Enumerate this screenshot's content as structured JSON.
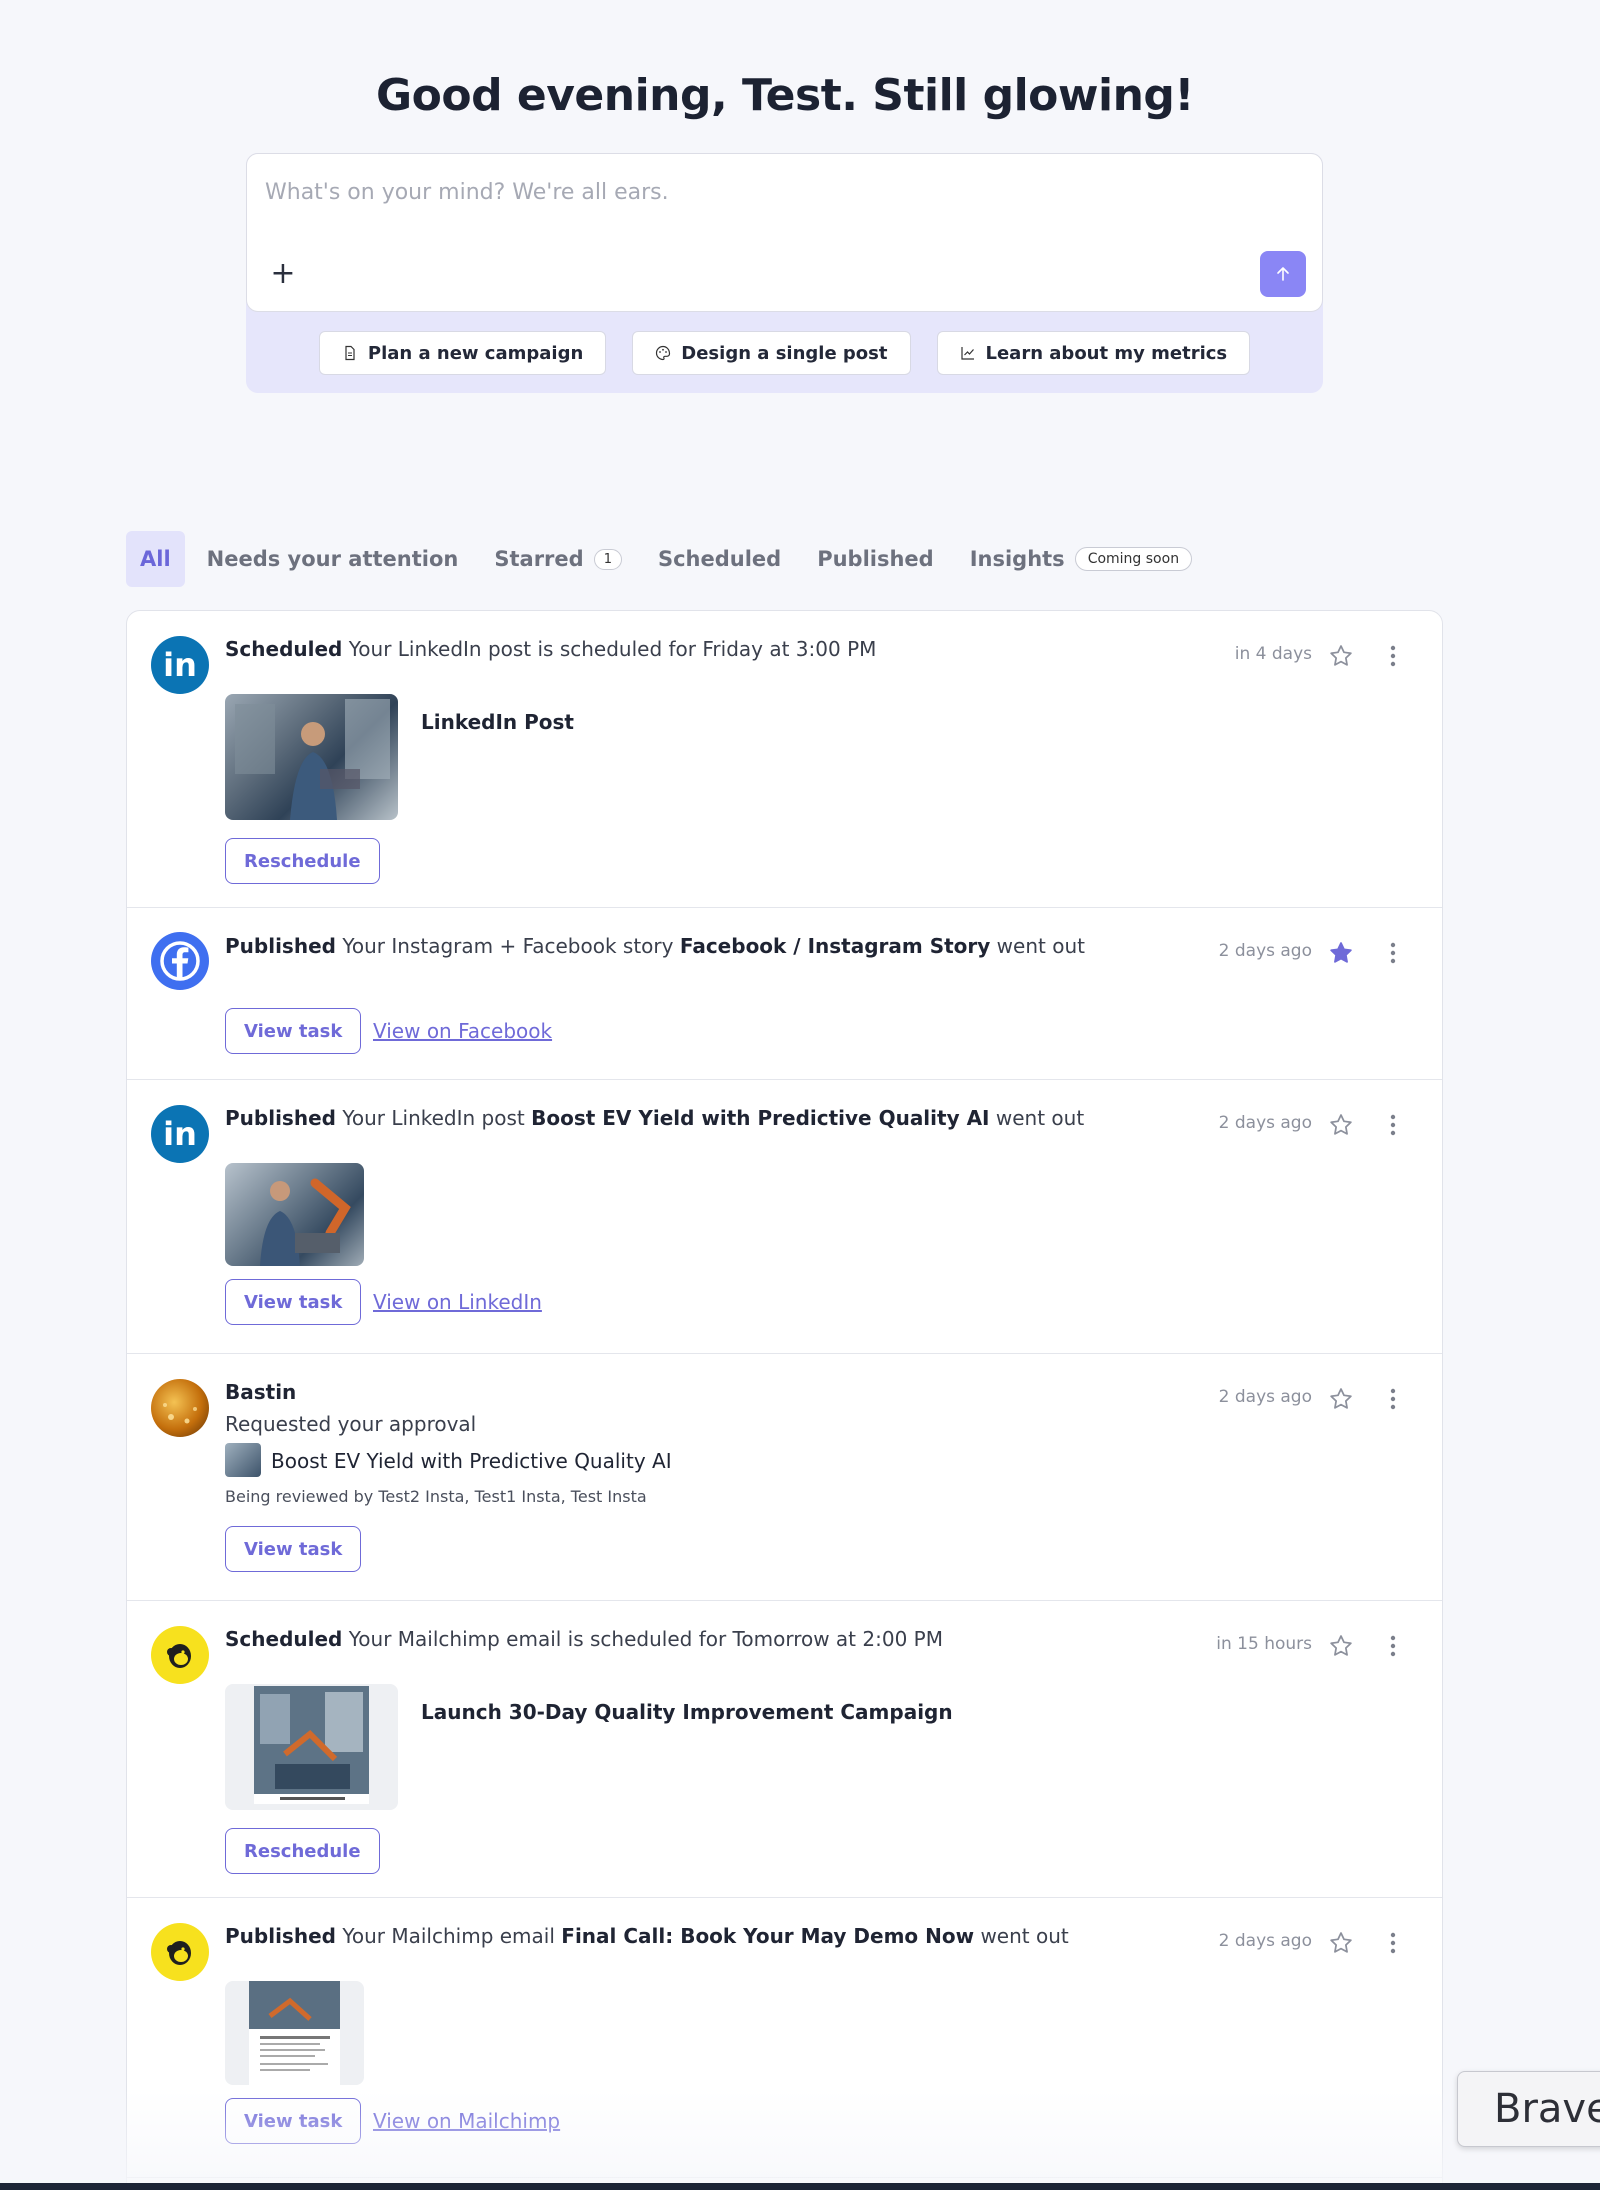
{
  "greeting": "Good evening, Test. Still glowing!",
  "composer": {
    "placeholder": "What's on your mind? We're all ears.",
    "plus_icon": "plus-icon",
    "send_icon": "arrow-up-icon"
  },
  "quick_actions": [
    {
      "label": "Plan a new campaign",
      "icon": "document-icon"
    },
    {
      "label": "Design a single post",
      "icon": "palette-icon"
    },
    {
      "label": "Learn about my metrics",
      "icon": "line-chart-icon"
    }
  ],
  "tabs": {
    "all": "All",
    "attention": "Needs your attention",
    "starred": "Starred",
    "starred_count": "1",
    "scheduled": "Scheduled",
    "published": "Published",
    "insights": "Insights",
    "insights_badge": "Coming soon"
  },
  "colors": {
    "accent": "#6f6ad8",
    "linkedin": "#0b74b4",
    "facebook": "#3f6ff0",
    "mailchimp": "#f7e11e"
  },
  "feed": {
    "item1": {
      "status": "Scheduled",
      "text": "Your LinkedIn post is scheduled for Friday at 3:00 PM",
      "time": "in 4 days",
      "post_title": "LinkedIn Post",
      "button": "Reschedule",
      "starred": false,
      "avatar_text": "in"
    },
    "item2": {
      "status": "Published",
      "text_before": "Your Instagram + Facebook story",
      "title": "Facebook / Instagram Story",
      "text_after": "went out",
      "time": "2 days ago",
      "button": "View task",
      "link": "View on Facebook",
      "starred": true
    },
    "item3": {
      "status": "Published",
      "text_before": "Your LinkedIn post",
      "title": "Boost EV Yield with Predictive Quality AI",
      "text_after": "went out",
      "time": "2 days ago",
      "button": "View task",
      "link": "View on LinkedIn",
      "starred": false,
      "avatar_text": "in"
    },
    "item4": {
      "name": "Bastin",
      "action": "Requested your approval",
      "task_title": "Boost EV Yield with Predictive Quality AI",
      "reviewers": "Being reviewed by Test2 Insta, Test1 Insta, Test Insta",
      "time": "2 days ago",
      "button": "View task",
      "starred": false
    },
    "item5": {
      "status": "Scheduled",
      "text": "Your Mailchimp email is scheduled for Tomorrow at 2:00 PM",
      "time": "in 15 hours",
      "post_title": "Launch 30-Day Quality Improvement Campaign",
      "button": "Reschedule",
      "starred": false
    },
    "item6": {
      "status": "Published",
      "text_before": "Your Mailchimp email",
      "title": "Final Call: Book Your May Demo Now",
      "text_after": "went out",
      "time": "2 days ago",
      "button": "View task",
      "link": "View on Mailchimp",
      "starred": false
    }
  },
  "popup": {
    "label": "Brave"
  }
}
